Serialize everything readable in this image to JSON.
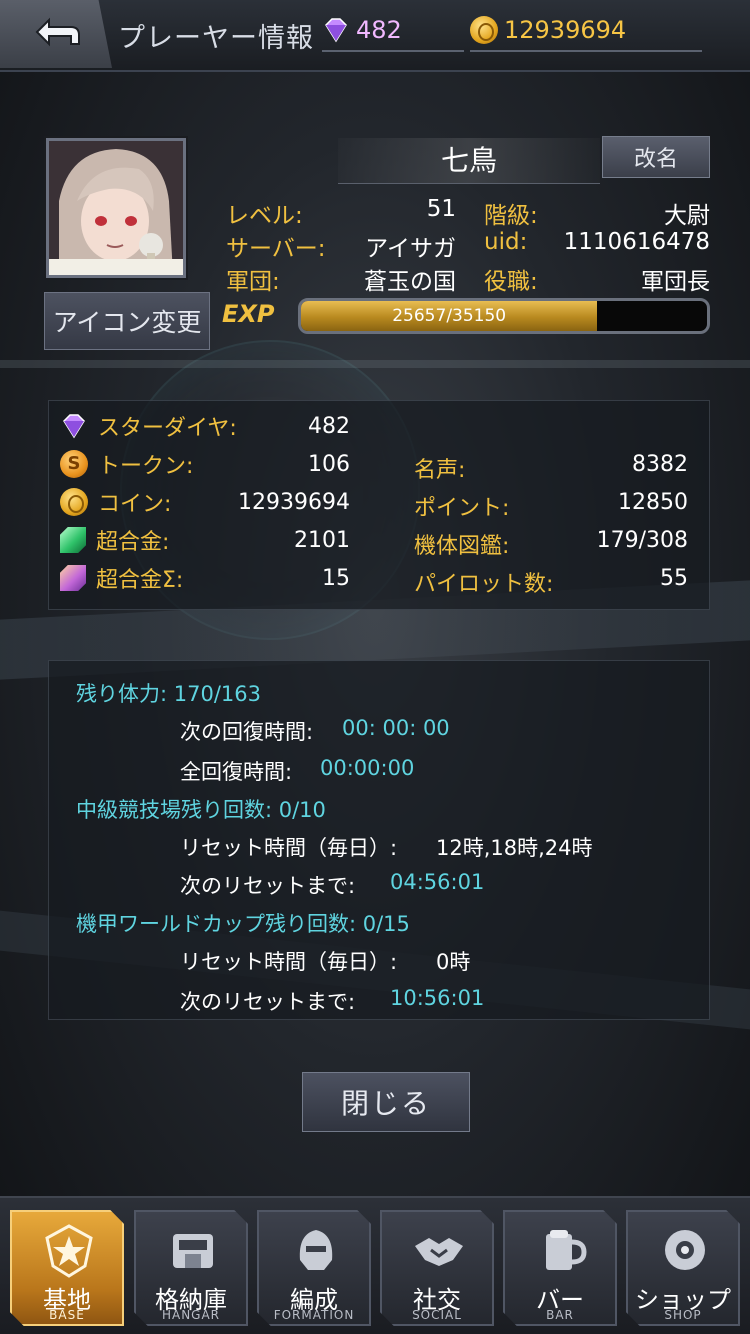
{
  "header": {
    "title": "プレーヤー情報",
    "diamonds": "482",
    "coins": "12939694"
  },
  "profile": {
    "name": "七鳥",
    "rename_label": "改名",
    "icon_change_label": "アイコン変更",
    "stats": [
      {
        "label": "レベル:",
        "value": "51"
      },
      {
        "label": "階級:",
        "value": "大尉"
      },
      {
        "label": "サーバー:",
        "value": "アイサガ"
      },
      {
        "label": "uid:",
        "value": "1110616478"
      },
      {
        "label": "軍団:",
        "value": "蒼玉の国"
      },
      {
        "label": "役職:",
        "value": "軍団長"
      }
    ],
    "exp_label": "EXP",
    "exp_text": "25657/35150",
    "exp_fraction": 0.73
  },
  "resources": {
    "left": [
      {
        "icon": "star-diamond-icon",
        "label": "スターダイヤ:",
        "value": "482"
      },
      {
        "icon": "token-icon",
        "label": "トークン:",
        "value": "106"
      },
      {
        "icon": "coin-icon",
        "label": "コイン:",
        "value": "12939694"
      },
      {
        "icon": "super-alloy-icon",
        "label": "超合金:",
        "value": "2101"
      },
      {
        "icon": "super-alloy-sigma-icon",
        "label": "超合金Σ:",
        "value": "15"
      }
    ],
    "right": [
      {
        "label": "名声:",
        "value": "8382"
      },
      {
        "label": "ポイント:",
        "value": "12850"
      },
      {
        "label": "機体図鑑:",
        "value": "179/308"
      },
      {
        "label": "パイロット数:",
        "value": "55"
      }
    ]
  },
  "timers": {
    "stamina_label": "残り体力: 170/163",
    "next_recovery_label": "次の回復時間:",
    "next_recovery_value": "00: 00: 00",
    "full_recovery_label": "全回復時間:",
    "full_recovery_value": "00:00:00",
    "arena_label": "中級競技場残り回数: 0/10",
    "arena_reset_label": "リセット時間（毎日）:",
    "arena_reset_value": "12時,18時,24時",
    "arena_next_label": "次のリセットまで:",
    "arena_next_value": "04:56:01",
    "worldcup_label": "機甲ワールドカップ残り回数: 0/15",
    "worldcup_reset_label": "リセット時間（毎日）:",
    "worldcup_reset_value": "0時",
    "worldcup_next_label": "次のリセットまで:",
    "worldcup_next_value": "10:56:01"
  },
  "close_label": "閉じる",
  "nav": [
    {
      "jp": "基地",
      "en": "BASE",
      "active": true
    },
    {
      "jp": "格納庫",
      "en": "HANGAR"
    },
    {
      "jp": "編成",
      "en": "FORMATION"
    },
    {
      "jp": "社交",
      "en": "SOCIAL"
    },
    {
      "jp": "バー",
      "en": "BAR"
    },
    {
      "jp": "ショップ",
      "en": "SHOP"
    }
  ],
  "colors": {
    "gold_label": "#f0c040",
    "cyan_label": "#5fd4e0",
    "diamond_text": "#f1b8ff",
    "coin_text": "#f7c545"
  }
}
